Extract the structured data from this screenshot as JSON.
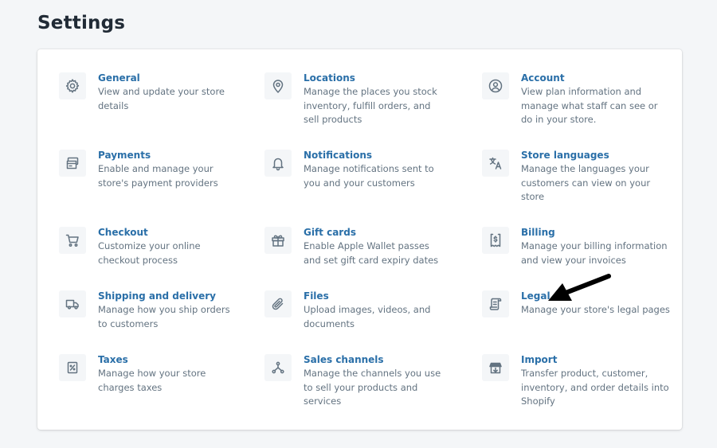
{
  "header": {
    "title": "Settings"
  },
  "settings": [
    {
      "title": "General",
      "description": "View and update your store details",
      "icon": "gear-icon"
    },
    {
      "title": "Locations",
      "description": "Manage the places you stock inventory, fulfill orders, and sell products",
      "icon": "location-pin-icon"
    },
    {
      "title": "Account",
      "description": "View plan information and manage what staff can see or do in your store.",
      "icon": "user-icon"
    },
    {
      "title": "Payments",
      "description": "Enable and manage your store's payment providers",
      "icon": "credit-card-icon"
    },
    {
      "title": "Notifications",
      "description": "Manage notifications sent to you and your customers",
      "icon": "bell-icon"
    },
    {
      "title": "Store languages",
      "description": "Manage the languages your customers can view on your store",
      "icon": "translate-icon"
    },
    {
      "title": "Checkout",
      "description": "Customize your online checkout process",
      "icon": "cart-icon"
    },
    {
      "title": "Gift cards",
      "description": "Enable Apple Wallet passes and set gift card expiry dates",
      "icon": "gift-icon"
    },
    {
      "title": "Billing",
      "description": "Manage your billing information and view your invoices",
      "icon": "invoice-icon"
    },
    {
      "title": "Shipping and delivery",
      "description": "Manage how you ship orders to customers",
      "icon": "truck-icon"
    },
    {
      "title": "Files",
      "description": "Upload images, videos, and documents",
      "icon": "paperclip-icon"
    },
    {
      "title": "Legal",
      "description": "Manage your store's legal pages",
      "icon": "scroll-icon"
    },
    {
      "title": "Taxes",
      "description": "Manage how your store charges taxes",
      "icon": "tax-icon"
    },
    {
      "title": "Sales channels",
      "description": "Manage the channels you use to sell your products and services",
      "icon": "channels-icon"
    },
    {
      "title": "Import",
      "description": "Transfer product, customer, inventory, and order details into Shopify",
      "icon": "import-icon"
    }
  ],
  "colors": {
    "link": "#2a6fa8",
    "description": "#637381",
    "icon_bg": "#f4f6f8",
    "page_bg": "#f4f6f8",
    "card_bg": "#ffffff",
    "annotation_arrow": "#000000"
  },
  "annotation": {
    "type": "arrow",
    "points_to": "Legal"
  }
}
